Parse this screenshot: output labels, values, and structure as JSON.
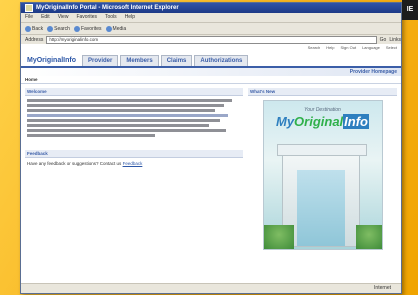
{
  "window": {
    "title": "MyOriginalInfo Portal - Microsoft Internet Explorer"
  },
  "menu": [
    "File",
    "Edit",
    "View",
    "Favorites",
    "Tools",
    "Help"
  ],
  "toolbar": {
    "back": "Back",
    "search": "Search",
    "favorites": "Favorites",
    "media": "Media"
  },
  "address": {
    "label": "Address",
    "value": "http://myoriginalinfo.com",
    "go": "Go",
    "links": "Links"
  },
  "top_links": [
    "Search",
    "Help",
    "Sign Out",
    "Language",
    "Select"
  ],
  "nav": {
    "logo": "MyOriginalInfo",
    "tabs": [
      "Provider",
      "Members",
      "Claims",
      "Authorizations"
    ]
  },
  "subbar": "Provider Homepage",
  "breadcrumb": "Home",
  "left": {
    "section1": "Welcome",
    "section2": "Feedback",
    "feedback_text": "Have any feedback or suggestions? Contact us",
    "feedback_link": "Feedback"
  },
  "right": {
    "section": "What's New",
    "poster_tag": "Your Destination",
    "poster_word1": "My",
    "poster_word2": "Original",
    "poster_word3": "Info"
  },
  "status": {
    "zone": "Internet"
  },
  "corner_label": "IE"
}
